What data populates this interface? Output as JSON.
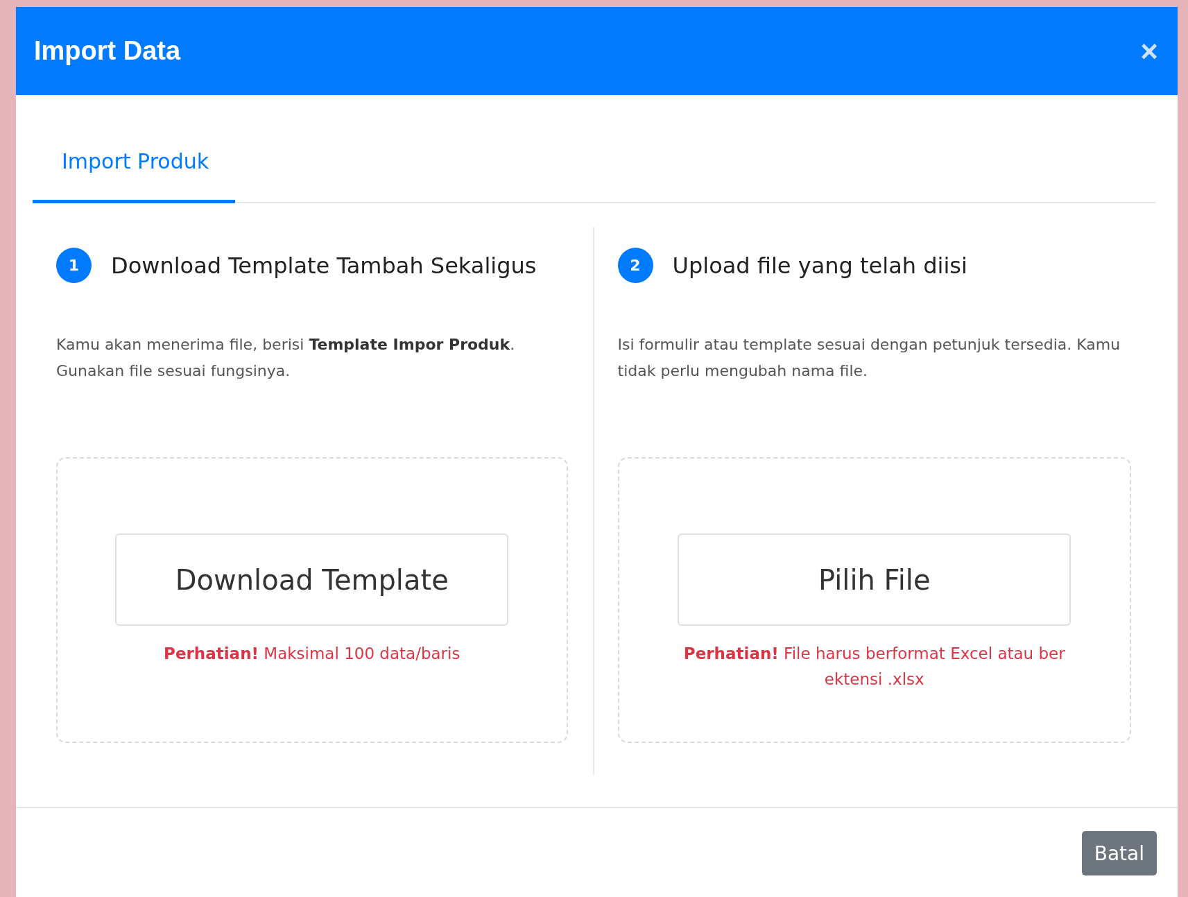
{
  "modal": {
    "title": "Import Data",
    "close": "×"
  },
  "tabs": [
    {
      "label": "Import Produk",
      "selected": true
    }
  ],
  "steps": [
    {
      "number": "1",
      "title": "Download Template Tambah Sekaligus",
      "description": "Kamu akan menerima file, berisi **Template Impor Produk**. Gunakan file sesuai fungsinya.",
      "button": "Download Template",
      "warning": "**Perhatian!** Maksimal 100 data/baris"
    },
    {
      "number": "2",
      "title": "Upload file yang telah diisi",
      "description": "Isi formulir atau template sesuai dengan petunjuk tersedia. Kamu tidak perlu mengubah nama file.",
      "button": "Pilih File",
      "warning": "**Perhatian!** File harus berformat Excel atau ber ektensi .xlsx"
    }
  ],
  "footer": {
    "cancel": "Batal"
  }
}
